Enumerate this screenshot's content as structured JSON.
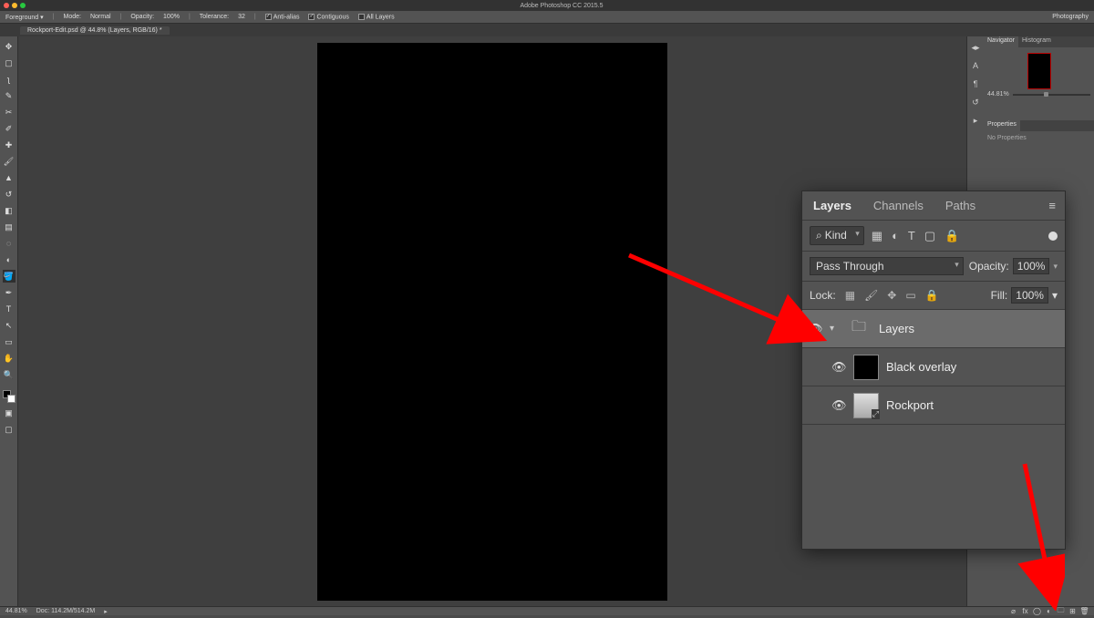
{
  "app": {
    "title": "Adobe Photoshop CC 2015.5"
  },
  "workspace": "Photography",
  "options_bar": {
    "tool_label": "Foreground ▾",
    "mode_label": "Mode:",
    "mode_value": "Normal",
    "opacity_label": "Opacity:",
    "opacity_value": "100%",
    "tolerance_label": "Tolerance:",
    "tolerance_value": "32",
    "antialias": "Anti-alias",
    "contiguous": "Contiguous",
    "all_layers": "All Layers"
  },
  "doc_tab": "Rockport-Edit.psd @ 44.8% (Layers, RGB/16) *",
  "navigator": {
    "tab1": "Navigator",
    "tab2": "Histogram",
    "zoom": "44.81%"
  },
  "properties": {
    "tab": "Properties",
    "empty": "No Properties"
  },
  "status": {
    "zoom": "44.81%",
    "doc": "Doc: 114.2M/514.2M"
  },
  "layers_panel": {
    "tabs": {
      "layers": "Layers",
      "channels": "Channels",
      "paths": "Paths"
    },
    "filter_kind": "Kind",
    "blend_mode": "Pass Through",
    "opacity_label": "Opacity:",
    "opacity_value": "100%",
    "lock_label": "Lock:",
    "fill_label": "Fill:",
    "fill_value": "100%",
    "items": [
      {
        "name": "Layers"
      },
      {
        "name": "Black overlay"
      },
      {
        "name": "Rockport"
      }
    ]
  }
}
